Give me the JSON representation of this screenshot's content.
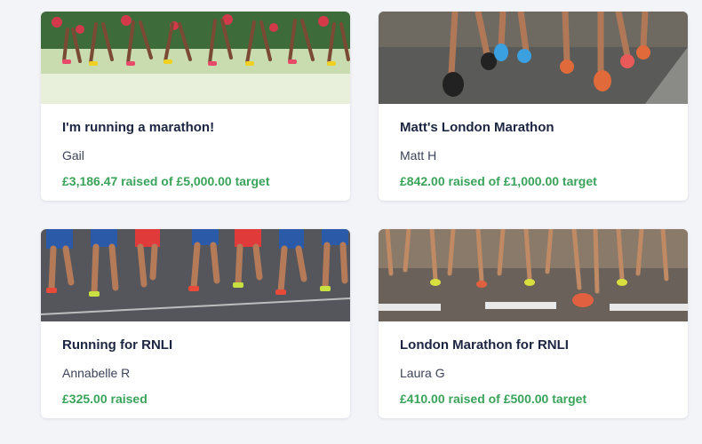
{
  "colors": {
    "page_bg": "#f3f4f8",
    "title": "#1c2541",
    "owner": "#3c4358",
    "raised": "#3aa35a"
  },
  "cards": [
    {
      "title": "I'm running a marathon!",
      "owner": "Gail",
      "raised_text": "£3,186.47 raised of £5,000.00 target",
      "image": "marathon-runners-photo"
    },
    {
      "title": "Matt's London Marathon",
      "owner": "Matt H",
      "raised_text": "£842.00 raised of £1,000.00 target",
      "image": "runners-feet-photo"
    },
    {
      "title": "Running for RNLI",
      "owner": "Annabelle R",
      "raised_text": "£325.00 raised",
      "image": "runners-legs-road-photo"
    },
    {
      "title": "London Marathon for RNLI",
      "owner": "Laura G",
      "raised_text": "£410.00 raised of £500.00 target",
      "image": "runners-crowd-road-photo"
    }
  ]
}
